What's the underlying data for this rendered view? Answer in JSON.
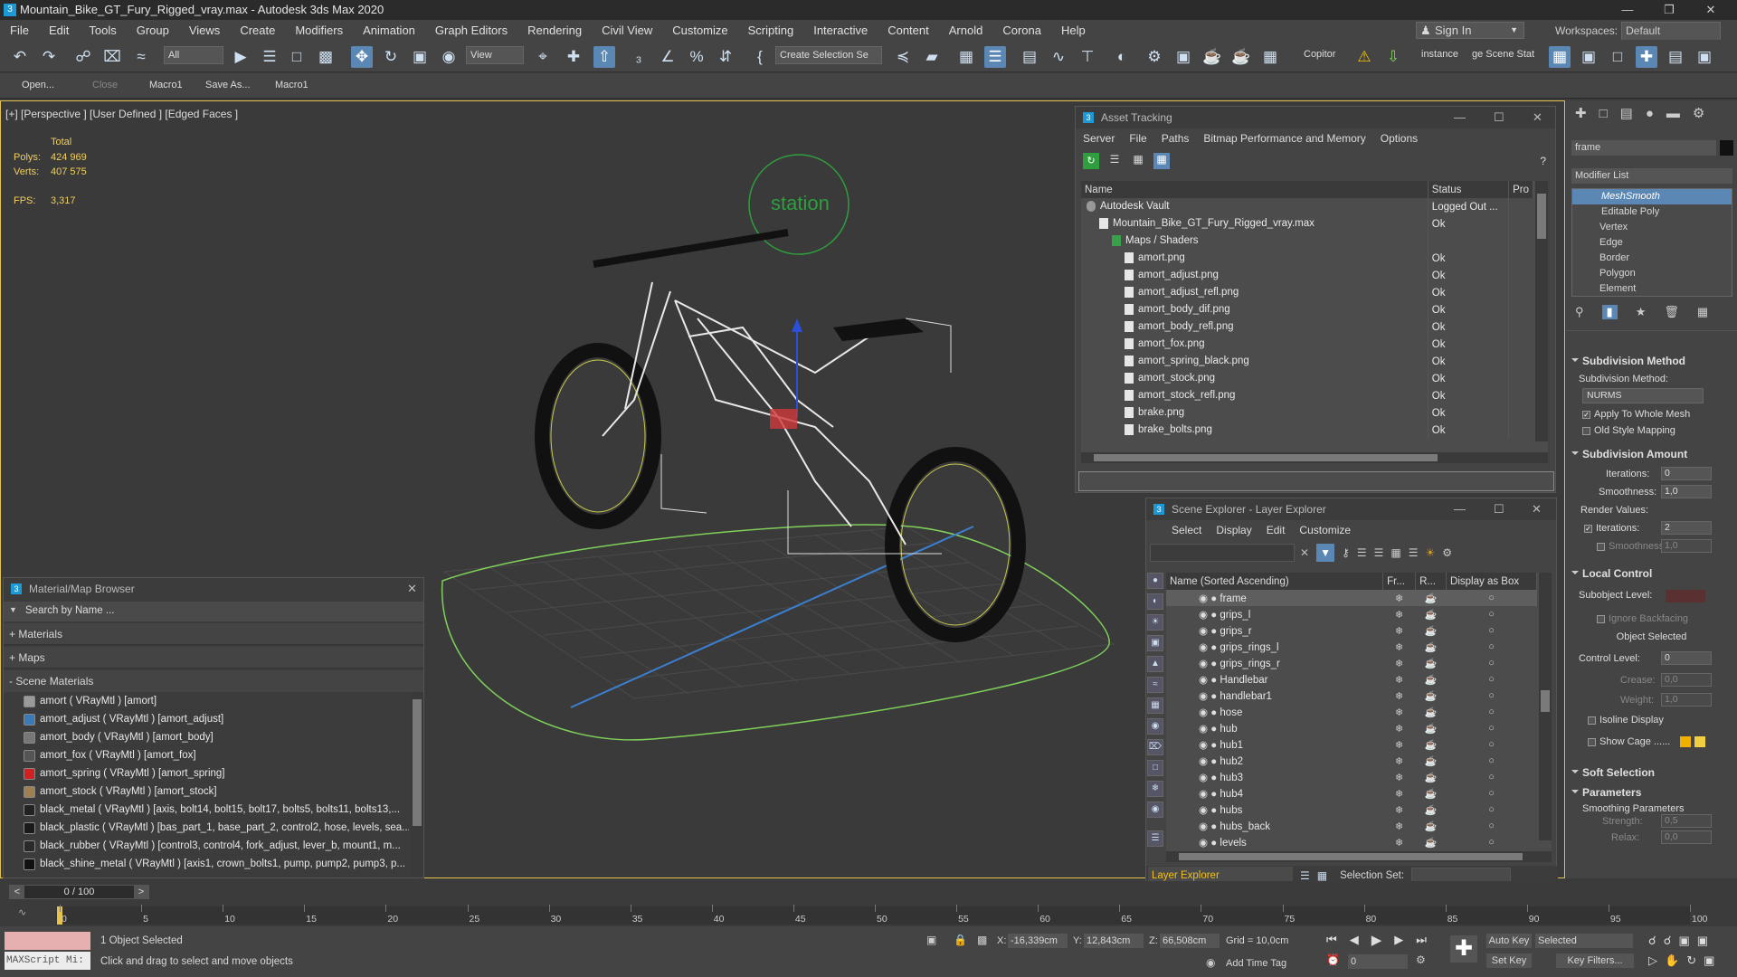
{
  "title": "Mountain_Bike_GT_Fury_Rigged_vray.max - Autodesk 3ds Max 2020",
  "menu": [
    "File",
    "Edit",
    "Tools",
    "Group",
    "Views",
    "Create",
    "Modifiers",
    "Animation",
    "Graph Editors",
    "Rendering",
    "Civil View",
    "Customize",
    "Scripting",
    "Interactive",
    "Content",
    "Arnold",
    "Corona",
    "Help"
  ],
  "signin": "Sign In",
  "workspaces_label": "Workspaces:",
  "workspaces_value": "Default",
  "toolbar": {
    "filter": "All",
    "refcoord": "View",
    "selset": "Create Selection Se",
    "copitor": "Copitor",
    "instance": "instance",
    "scene_stat": "ge Scene Stat"
  },
  "cmdbar": {
    "open": "Open...",
    "close": "Close",
    "macro1": "Macro1",
    "saveas": "Save As...",
    "macro1b": "Macro1"
  },
  "viewport": {
    "label": "[+] [Perspective ] [User Defined ] [Edged Faces ]",
    "total": "Total",
    "polys_label": "Polys:",
    "polys": "424 969",
    "verts_label": "Verts:",
    "verts": "407 575",
    "fps_label": "FPS:",
    "fps": "3,317",
    "sign": "station"
  },
  "asset": {
    "title": "Asset Tracking",
    "menu": [
      "Server",
      "File",
      "Paths",
      "Bitmap Performance and Memory",
      "Options"
    ],
    "cols": [
      "Name",
      "Status",
      "Pro"
    ],
    "rows": [
      {
        "name": "Autodesk Vault",
        "status": "Logged Out ...",
        "indent": 0
      },
      {
        "name": "Mountain_Bike_GT_Fury_Rigged_vray.max",
        "status": "Ok",
        "indent": 1
      },
      {
        "name": "Maps / Shaders",
        "status": "",
        "indent": 2
      },
      {
        "name": "amort.png",
        "status": "Ok",
        "indent": 3
      },
      {
        "name": "amort_adjust.png",
        "status": "Ok",
        "indent": 3
      },
      {
        "name": "amort_adjust_refl.png",
        "status": "Ok",
        "indent": 3
      },
      {
        "name": "amort_body_dif.png",
        "status": "Ok",
        "indent": 3
      },
      {
        "name": "amort_body_refl.png",
        "status": "Ok",
        "indent": 3
      },
      {
        "name": "amort_fox.png",
        "status": "Ok",
        "indent": 3
      },
      {
        "name": "amort_spring_black.png",
        "status": "Ok",
        "indent": 3
      },
      {
        "name": "amort_stock.png",
        "status": "Ok",
        "indent": 3
      },
      {
        "name": "amort_stock_refl.png",
        "status": "Ok",
        "indent": 3
      },
      {
        "name": "brake.png",
        "status": "Ok",
        "indent": 3
      },
      {
        "name": "brake_bolts.png",
        "status": "Ok",
        "indent": 3
      }
    ]
  },
  "matbrowser": {
    "title": "Material/Map Browser",
    "search": "Search by Name ...",
    "materials": "+ Materials",
    "maps": "+ Maps",
    "scene": "- Scene Materials",
    "items": [
      {
        "text": "amort  ( VRayMtl ) [amort]",
        "color": "#9a9a9a"
      },
      {
        "text": "amort_adjust  ( VRayMtl ) [amort_adjust]",
        "color": "#3a7ab8"
      },
      {
        "text": "amort_body  ( VRayMtl ) [amort_body]",
        "color": "#777777"
      },
      {
        "text": "amort_fox  ( VRayMtl ) [amort_fox]",
        "color": "#555555"
      },
      {
        "text": "amort_spring  ( VRayMtl ) [amort_spring]",
        "color": "#d02020"
      },
      {
        "text": "amort_stock  ( VRayMtl ) [amort_stock]",
        "color": "#a08050"
      },
      {
        "text": "black_metal  ( VRayMtl ) [axis, bolt14, bolt15, bolt17, bolts5, bolts11, bolts13,...",
        "color": "#222222"
      },
      {
        "text": "black_plastic  ( VRayMtl ) [bas_part_1, base_part_2, control2, hose, levels, sea...",
        "color": "#1a1a1a"
      },
      {
        "text": "black_rubber  ( VRayMtl ) [control3, control4, fork_adjust, lever_b, mount1, m...",
        "color": "#2a2a2a"
      },
      {
        "text": "black_shine_metal  ( VRayMtl ) [axis1, crown_bolts1, pump, pump2, pump3, p...",
        "color": "#111111"
      }
    ]
  },
  "scene": {
    "title": "Scene Explorer - Layer Explorer",
    "menu": [
      "Select",
      "Display",
      "Edit",
      "Customize"
    ],
    "cols": [
      "Name (Sorted Ascending)",
      "Fr...",
      "R...",
      "Display as Box"
    ],
    "rows": [
      "frame",
      "grips_l",
      "grips_r",
      "grips_rings_l",
      "grips_rings_r",
      "Handlebar",
      "handlebar1",
      "hose",
      "hub",
      "hub1",
      "hub2",
      "hub3",
      "hub4",
      "hubs",
      "hubs_back",
      "levels"
    ],
    "footer": "Layer Explorer",
    "selset": "Selection Set:"
  },
  "cmd": {
    "objname": "frame",
    "modlist": "Modifier List",
    "stack": [
      "MeshSmooth",
      "Editable Poly",
      "Vertex",
      "Edge",
      "Border",
      "Polygon",
      "Element"
    ],
    "subdiv_method_title": "Subdivision Method",
    "subdiv_method_label": "Subdivision Method:",
    "subdiv_method": "NURMS",
    "apply_whole": "Apply To Whole Mesh",
    "old_style": "Old Style Mapping",
    "subdiv_amount_title": "Subdivision Amount",
    "iterations_label": "Iterations:",
    "iterations": "0",
    "smoothness_label": "Smoothness:",
    "smoothness": "1,0",
    "render_values": "Render Values:",
    "r_iterations": "2",
    "r_smoothness": "1,0",
    "local_title": "Local Control",
    "subobj_label": "Subobject Level:",
    "ignore_bf": "Ignore Backfacing",
    "obj_selected": "Object Selected",
    "ctrl_level_label": "Control Level:",
    "ctrl_level": "0",
    "crease_label": "Crease:",
    "crease": "0,0",
    "weight_label": "Weight:",
    "weight": "1,0",
    "isoline": "Isoline Display",
    "show_cage": "Show Cage ......",
    "soft_title": "Soft Selection",
    "params_title": "Parameters",
    "smoothing_params": "Smoothing Parameters",
    "strength_label": "Strength:",
    "strength": "0,5",
    "relax_label": "Relax:",
    "relax": "0,0"
  },
  "timeline": {
    "frame": "0 / 100",
    "ticks": [
      "0",
      "5",
      "10",
      "15",
      "20",
      "25",
      "30",
      "35",
      "40",
      "45",
      "50",
      "55",
      "60",
      "65",
      "70",
      "75",
      "80",
      "85",
      "90",
      "95",
      "100"
    ]
  },
  "status": {
    "selected": "1 Object Selected",
    "hint": "Click and drag to select and move objects",
    "maxscript": "MAXScript Mi:",
    "x_label": "X:",
    "x": "-16,339cm",
    "y_label": "Y:",
    "y": "12,843cm",
    "z_label": "Z:",
    "z": "66,508cm",
    "grid": "Grid = 10,0cm",
    "addtime": "Add Time Tag",
    "autokey": "Auto Key",
    "setkey": "Set Key",
    "selected_dd": "Selected",
    "keyfilters": "Key Filters...",
    "frame_val": "0"
  }
}
